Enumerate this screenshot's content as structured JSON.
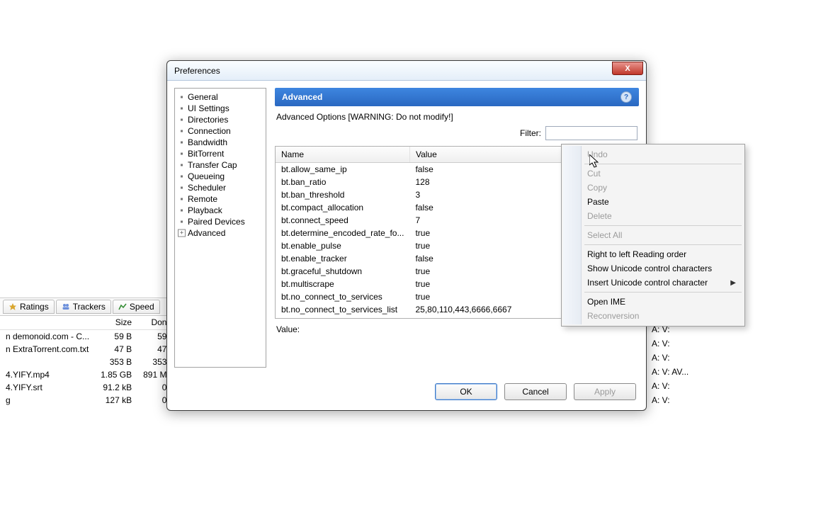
{
  "bg": {
    "tabs": [
      {
        "icon": "star",
        "label": "Ratings"
      },
      {
        "icon": "group",
        "label": "Trackers"
      },
      {
        "icon": "chart",
        "label": "Speed"
      }
    ],
    "cols": [
      "",
      "Size",
      "Don"
    ],
    "rows": [
      {
        "name": "n demonoid.com - C...",
        "size": "59 B",
        "done": "59"
      },
      {
        "name": "n ExtraTorrent.com.txt",
        "size": "47 B",
        "done": "47"
      },
      {
        "name": "",
        "size": "353 B",
        "done": "353"
      },
      {
        "name": "4.YIFY.mp4",
        "size": "1.85 GB",
        "done": "891 M"
      },
      {
        "name": "4.YIFY.srt",
        "size": "91.2 kB",
        "done": "0"
      },
      {
        "name": "g",
        "size": "127 kB",
        "done": "0"
      }
    ],
    "av_header": "",
    "av_rows": [
      "A:   V:",
      "A:   V:",
      "A:   V:",
      "A:   V: AV...",
      "A:   V:",
      "A:   V:"
    ]
  },
  "dialog": {
    "title": "Preferences",
    "tree": [
      {
        "label": "General",
        "kind": "dot"
      },
      {
        "label": "UI Settings",
        "kind": "dot"
      },
      {
        "label": "Directories",
        "kind": "dot"
      },
      {
        "label": "Connection",
        "kind": "dot"
      },
      {
        "label": "Bandwidth",
        "kind": "dot"
      },
      {
        "label": "BitTorrent",
        "kind": "dot"
      },
      {
        "label": "Transfer Cap",
        "kind": "dot"
      },
      {
        "label": "Queueing",
        "kind": "dot"
      },
      {
        "label": "Scheduler",
        "kind": "dot"
      },
      {
        "label": "Remote",
        "kind": "dot"
      },
      {
        "label": "Playback",
        "kind": "dot"
      },
      {
        "label": "Paired Devices",
        "kind": "dot"
      },
      {
        "label": "Advanced",
        "kind": "plus",
        "selected": true
      }
    ],
    "section_title": "Advanced",
    "help": "?",
    "warning": "Advanced Options [WARNING: Do not modify!]",
    "filter_label": "Filter:",
    "filter_value": "",
    "filter_placeholder": "",
    "table": {
      "cols": [
        "Name",
        "Value"
      ],
      "rows": [
        {
          "name": "bt.allow_same_ip",
          "value": "false"
        },
        {
          "name": "bt.ban_ratio",
          "value": "128"
        },
        {
          "name": "bt.ban_threshold",
          "value": "3"
        },
        {
          "name": "bt.compact_allocation",
          "value": "false"
        },
        {
          "name": "bt.connect_speed",
          "value": "7"
        },
        {
          "name": "bt.determine_encoded_rate_fo...",
          "value": "true"
        },
        {
          "name": "bt.enable_pulse",
          "value": "true"
        },
        {
          "name": "bt.enable_tracker",
          "value": "false"
        },
        {
          "name": "bt.graceful_shutdown",
          "value": "true"
        },
        {
          "name": "bt.multiscrape",
          "value": "true"
        },
        {
          "name": "bt.no_connect_to_services",
          "value": "true"
        },
        {
          "name": "bt.no_connect_to_services_list",
          "value": "25,80,110,443,6666,6667"
        }
      ]
    },
    "value_label": "Value:",
    "buttons": {
      "ok": "OK",
      "cancel": "Cancel",
      "apply": "Apply"
    }
  },
  "ctx": {
    "items": [
      {
        "label": "Undo",
        "disabled": true
      },
      {
        "sep": true
      },
      {
        "label": "Cut",
        "disabled": true
      },
      {
        "label": "Copy",
        "disabled": true
      },
      {
        "label": "Paste"
      },
      {
        "label": "Delete",
        "disabled": true
      },
      {
        "sep": true
      },
      {
        "label": "Select All",
        "disabled": true
      },
      {
        "sep": true
      },
      {
        "label": "Right to left Reading order"
      },
      {
        "label": "Show Unicode control characters"
      },
      {
        "label": "Insert Unicode control character",
        "submenu": true
      },
      {
        "sep": true
      },
      {
        "label": "Open IME"
      },
      {
        "label": "Reconversion",
        "disabled": true
      }
    ]
  }
}
